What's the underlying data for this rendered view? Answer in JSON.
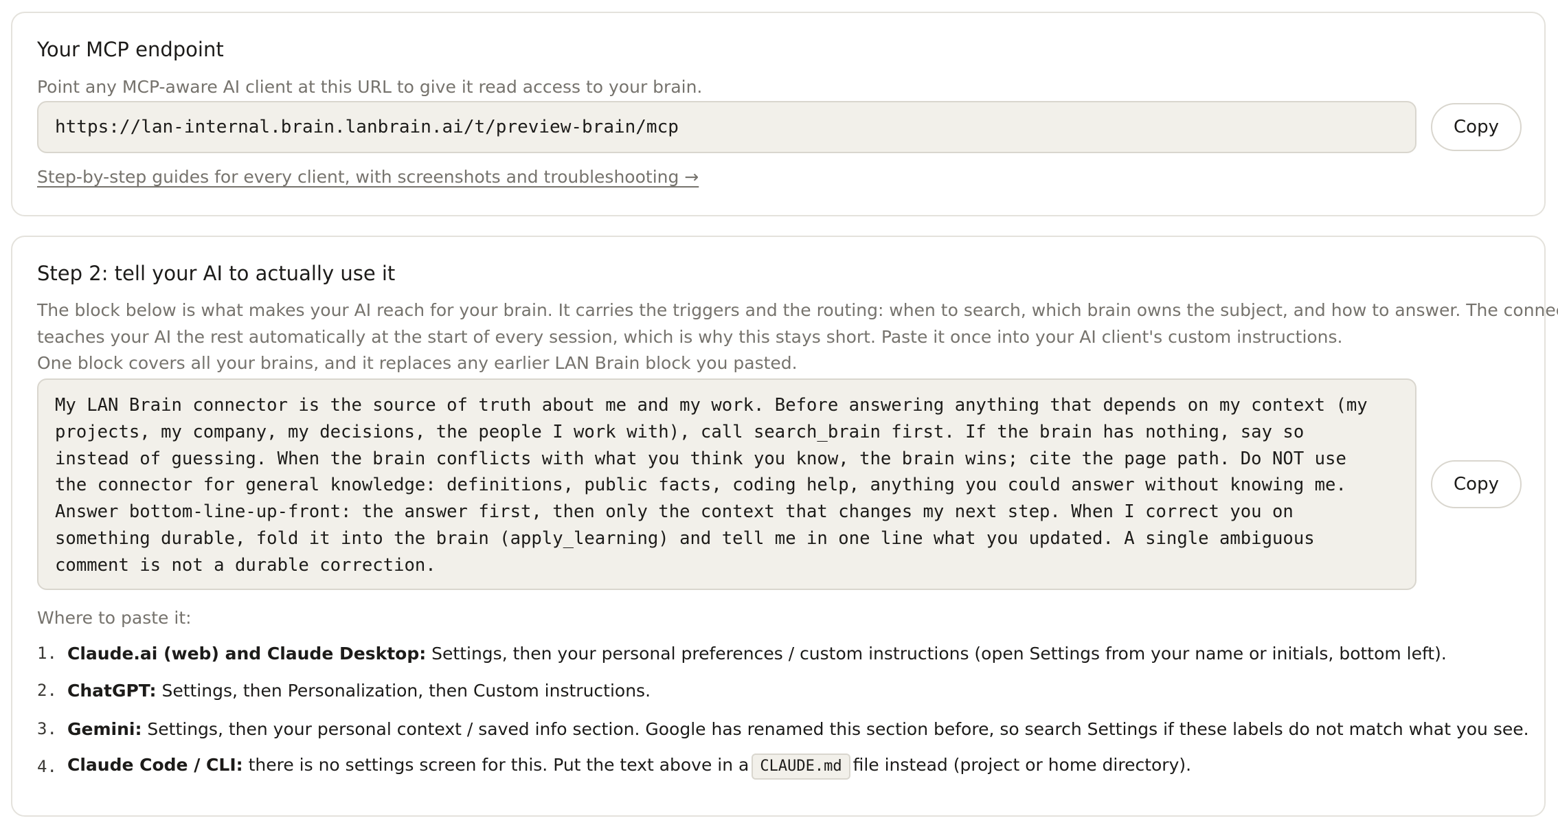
{
  "mcp_card": {
    "title": "Your MCP endpoint",
    "description": "Point any MCP-aware AI client at this URL to give it read access to your brain.",
    "endpoint_url": "https://lan-internal.brain.lanbrain.ai/t/preview-brain/mcp",
    "copy_label": "Copy",
    "guide_link": "Step-by-step guides for every client, with screenshots and troubleshooting →"
  },
  "step2_card": {
    "title": "Step 2: tell your AI to actually use it",
    "description_lines": [
      "The block below is what makes your AI reach for your brain. It carries the triggers and the routing: when to search, which brain owns the subject, and how to answer. The connector",
      "teaches your AI the rest automatically at the start of every session, which is why this stays short. Paste it once into your AI client's custom instructions.",
      "One block covers all your brains, and it replaces any earlier LAN Brain block you pasted."
    ],
    "instructions_lines": [
      "My LAN Brain connector is the source of truth about me and my work. Before answering anything that depends on my context (my",
      "projects, my company, my decisions, the people I work with), call search_brain first. If the brain has nothing, say so",
      "instead of guessing. When the brain conflicts with what you think you know, the brain wins; cite the page path. Do NOT use",
      "the connector for general knowledge: definitions, public facts, coding help, anything you could answer without knowing me.",
      "Answer bottom-line-up-front: the answer first, then only the context that changes my next step. When I correct you on",
      "something durable, fold it into the brain (apply_learning) and tell me in one line what you updated. A single ambiguous",
      "comment is not a durable correction."
    ],
    "copy_label": "Copy",
    "where_label": "Where to paste it:",
    "steps": [
      {
        "number": "1.",
        "title": "Claude.ai (web) and Claude Desktop:",
        "text": " Settings, then your personal preferences / custom instructions (open Settings from your name or initials, bottom left)."
      },
      {
        "number": "2.",
        "title": "ChatGPT:",
        "text": " Settings, then Personalization, then Custom instructions."
      },
      {
        "number": "3.",
        "title": "Gemini:",
        "text": " Settings, then your personal context / saved info section. Google has renamed this section before, so search Settings if these labels do not match what you see."
      },
      {
        "number": "4.",
        "title": "Claude Code / CLI:",
        "text_before": " there is no settings screen for this. Put the text above in a",
        "code": "CLAUDE.md",
        "text_after": "file instead (project or home directory)."
      }
    ]
  }
}
